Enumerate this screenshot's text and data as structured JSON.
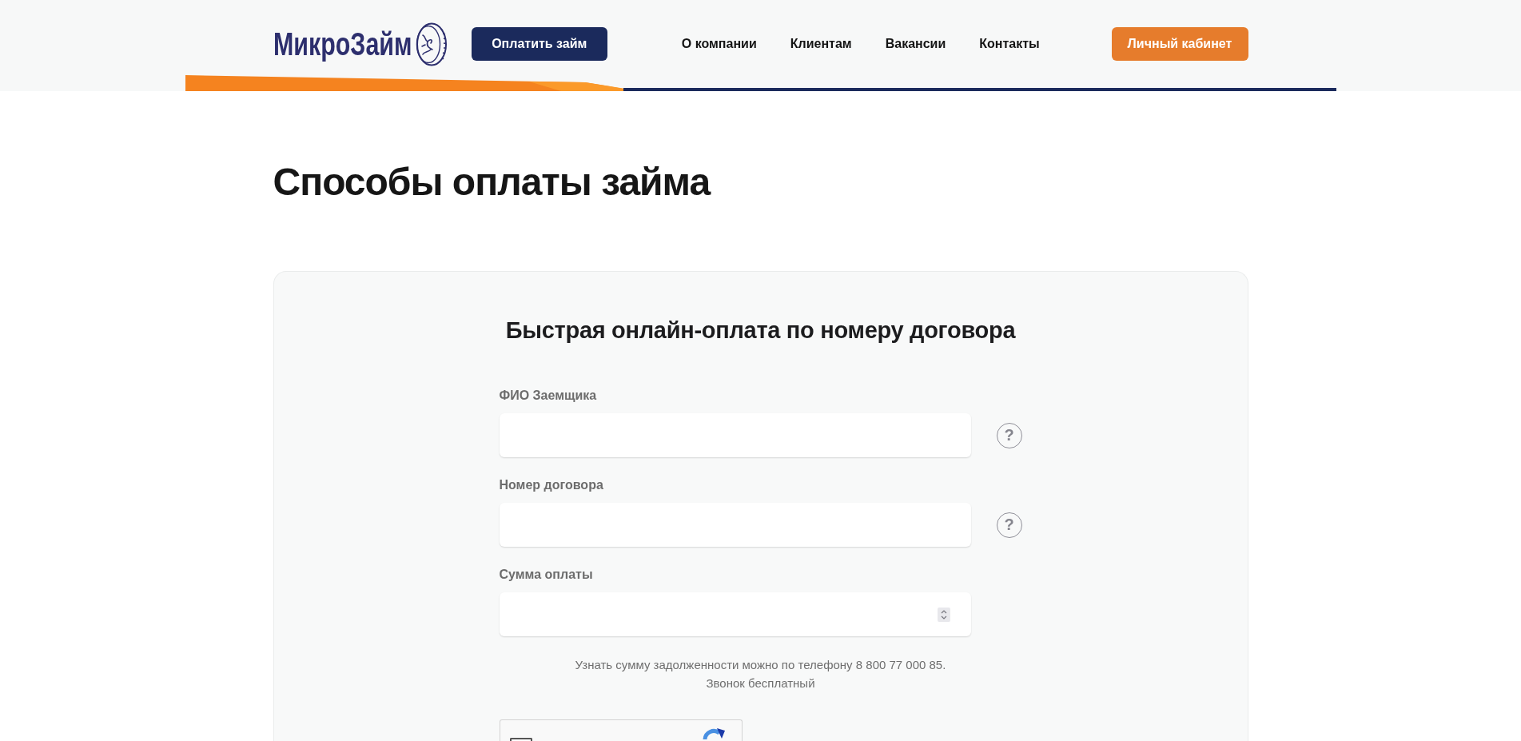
{
  "header": {
    "logo": "МикроЗайм",
    "pay_button": "Оплатить займ",
    "nav": [
      "О компании",
      "Клиентам",
      "Вакансии",
      "Контакты"
    ],
    "account_button": "Личный кабинет"
  },
  "page_title": "Способы оплаты займа",
  "payment_form": {
    "title": "Быстрая онлайн-оплата по номеру договора",
    "fields": [
      {
        "label": "ФИО Заемщика",
        "kind": "text",
        "help": "?"
      },
      {
        "label": "Номер договора",
        "kind": "text",
        "help": "?"
      },
      {
        "label": "Сумма оплаты",
        "kind": "number"
      }
    ],
    "hint_lines": [
      "Узнать сумму задолженности можно по телефону 8 800 77 000 85.",
      "Звонок бесплатный"
    ],
    "captcha": {
      "checked": false
    }
  }
}
